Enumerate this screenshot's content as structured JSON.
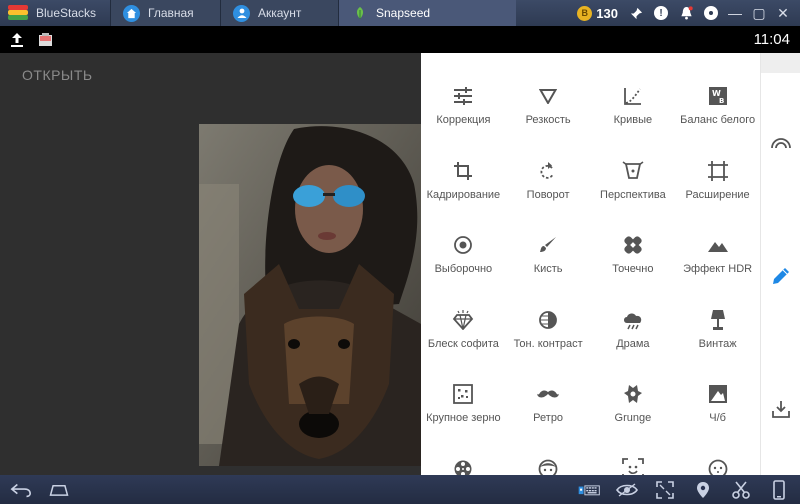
{
  "titlebar": {
    "brand": "BlueStacks",
    "tabs": [
      {
        "label": "Главная",
        "icon": "home-icon"
      },
      {
        "label": "Аккаунт",
        "icon": "account-icon"
      },
      {
        "label": "Snapseed",
        "icon": "snapseed-icon",
        "active": true
      }
    ],
    "coins": "130",
    "colors": {
      "bar": "#2e3a52",
      "active_tab": "#4a5878",
      "coin": "#e8b322"
    }
  },
  "statusbar": {
    "time": "11:04"
  },
  "app": {
    "open_label": "ОТКРЫТЬ",
    "accent": "#1e88e5",
    "tools": [
      {
        "label": "Коррекция",
        "icon": "tune-icon"
      },
      {
        "label": "Резкость",
        "icon": "details-triangle-icon"
      },
      {
        "label": "Кривые",
        "icon": "curves-icon"
      },
      {
        "label": "Баланс белого",
        "icon": "white-balance-icon"
      },
      {
        "label": "Кадрирование",
        "icon": "crop-icon"
      },
      {
        "label": "Поворот",
        "icon": "rotate-icon"
      },
      {
        "label": "Перспектива",
        "icon": "perspective-icon"
      },
      {
        "label": "Расширение",
        "icon": "expand-icon"
      },
      {
        "label": "Выборочно",
        "icon": "selective-icon"
      },
      {
        "label": "Кисть",
        "icon": "brush-icon"
      },
      {
        "label": "Точечно",
        "icon": "healing-icon"
      },
      {
        "label": "Эффект HDR",
        "icon": "hdr-mountain-icon"
      },
      {
        "label": "Блеск софита",
        "icon": "glamour-glow-icon"
      },
      {
        "label": "Тон. контраст",
        "icon": "tonal-contrast-icon"
      },
      {
        "label": "Драма",
        "icon": "drama-cloud-icon"
      },
      {
        "label": "Винтаж",
        "icon": "vintage-lamp-icon"
      },
      {
        "label": "Крупное зерно",
        "icon": "grainy-film-icon"
      },
      {
        "label": "Ретро",
        "icon": "mustache-icon"
      },
      {
        "label": "Grunge",
        "icon": "grunge-icon"
      },
      {
        "label": "Ч/б",
        "icon": "black-white-icon"
      },
      {
        "label": "",
        "icon": "film-reel-icon"
      },
      {
        "label": "",
        "icon": "face-icon"
      },
      {
        "label": "",
        "icon": "face-frame-icon"
      },
      {
        "label": "",
        "icon": "face-dots-icon"
      }
    ]
  }
}
